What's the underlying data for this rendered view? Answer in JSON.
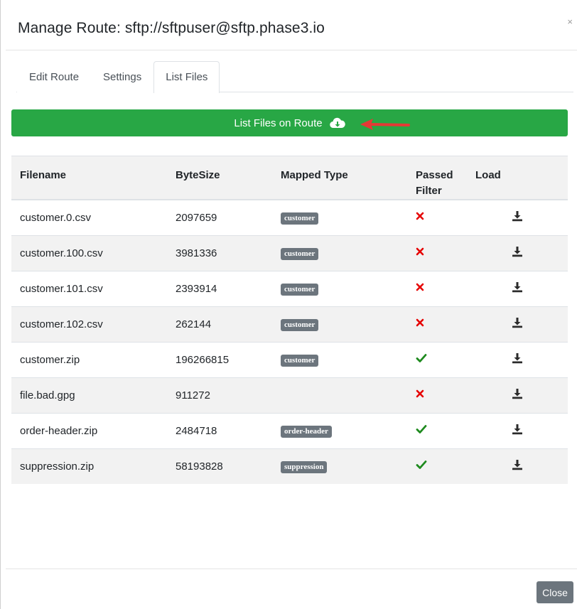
{
  "modal": {
    "title": "Manage Route: sftp://sftpuser@sftp.phase3.io",
    "close_symbol": "×"
  },
  "tabs": [
    {
      "label": "Edit Route",
      "active": false
    },
    {
      "label": "Settings",
      "active": false
    },
    {
      "label": "List Files",
      "active": true
    }
  ],
  "list_button": {
    "label": "List Files on Route",
    "icon": "cloud-download-icon"
  },
  "table": {
    "headers": {
      "filename": "Filename",
      "bytesize": "ByteSize",
      "mapped_type": "Mapped Type",
      "passed_filter_1": "Passed",
      "passed_filter_2": "Filter",
      "load": "Load"
    },
    "rows": [
      {
        "filename": "customer.0.csv",
        "bytesize": "2097659",
        "mapped_type": "customer",
        "passed": false
      },
      {
        "filename": "customer.100.csv",
        "bytesize": "3981336",
        "mapped_type": "customer",
        "passed": false
      },
      {
        "filename": "customer.101.csv",
        "bytesize": "2393914",
        "mapped_type": "customer",
        "passed": false
      },
      {
        "filename": "customer.102.csv",
        "bytesize": "262144",
        "mapped_type": "customer",
        "passed": false
      },
      {
        "filename": "customer.zip",
        "bytesize": "196266815",
        "mapped_type": "customer",
        "passed": true
      },
      {
        "filename": "file.bad.gpg",
        "bytesize": "911272",
        "mapped_type": "",
        "passed": false
      },
      {
        "filename": "order-header.zip",
        "bytesize": "2484718",
        "mapped_type": "order-header",
        "passed": true
      },
      {
        "filename": "suppression.zip",
        "bytesize": "58193828",
        "mapped_type": "suppression",
        "passed": true
      }
    ]
  },
  "footer": {
    "close_label": "Close"
  },
  "colors": {
    "primary_green": "#28a745",
    "badge_gray": "#6c757d",
    "fail_red": "#e60000",
    "pass_green": "#1e8a1e",
    "annotation_arrow": "#e53935"
  }
}
